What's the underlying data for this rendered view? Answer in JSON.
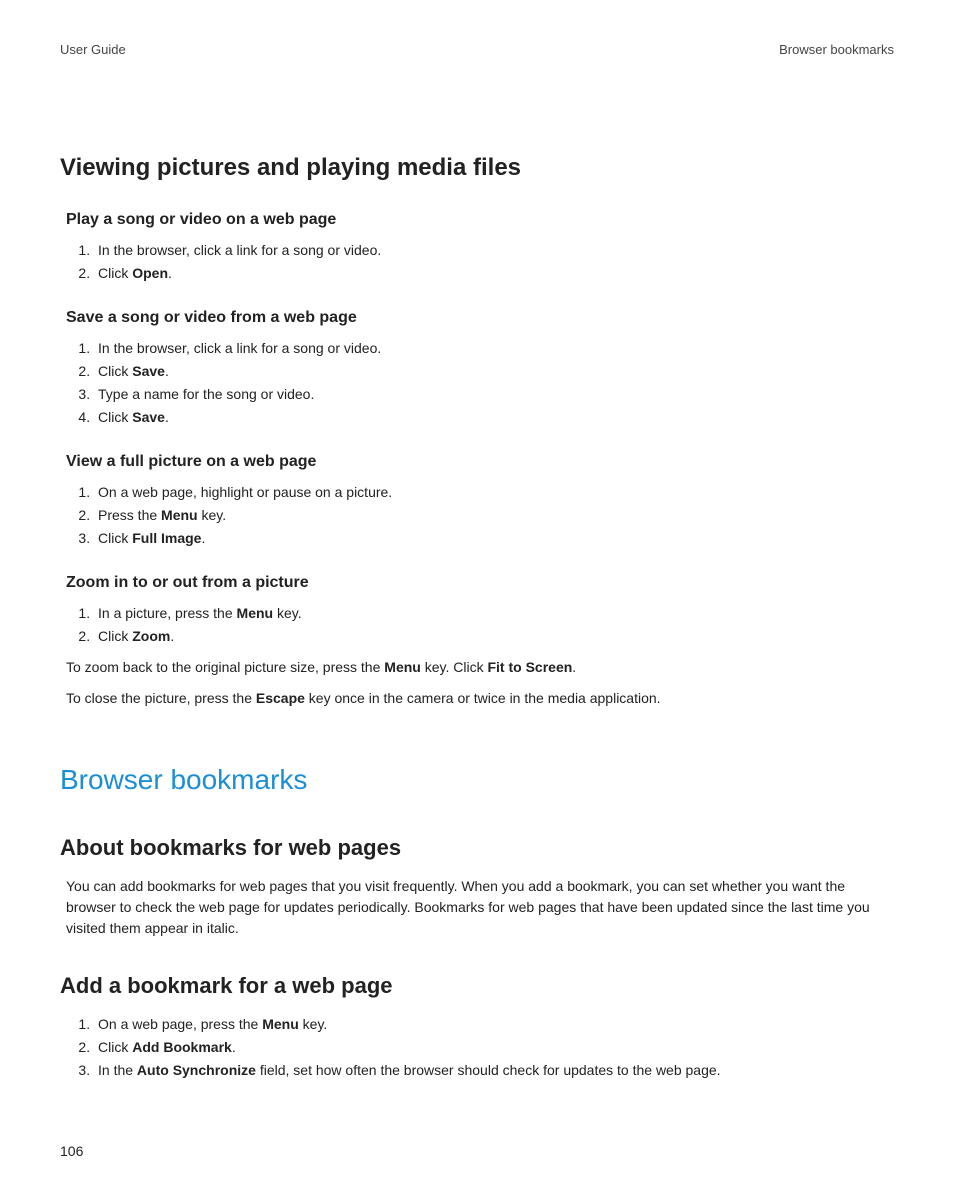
{
  "header": {
    "left": "User Guide",
    "right": "Browser bookmarks"
  },
  "section1": {
    "title": "Viewing pictures and playing media files",
    "topics": [
      {
        "title": "Play a song or video on a web page",
        "steps": [
          [
            {
              "t": "In the browser, click a link for a song or video."
            }
          ],
          [
            {
              "t": "Click "
            },
            {
              "b": "Open"
            },
            {
              "t": "."
            }
          ]
        ]
      },
      {
        "title": "Save a song or video from a web page",
        "steps": [
          [
            {
              "t": "In the browser, click a link for a song or video."
            }
          ],
          [
            {
              "t": "Click "
            },
            {
              "b": "Save"
            },
            {
              "t": "."
            }
          ],
          [
            {
              "t": "Type a name for the song or video."
            }
          ],
          [
            {
              "t": "Click "
            },
            {
              "b": "Save"
            },
            {
              "t": "."
            }
          ]
        ]
      },
      {
        "title": "View a full picture on a web page",
        "steps": [
          [
            {
              "t": "On a web page, highlight or pause on a picture."
            }
          ],
          [
            {
              "t": "Press the "
            },
            {
              "b": "Menu"
            },
            {
              "t": " key."
            }
          ],
          [
            {
              "t": "Click "
            },
            {
              "b": "Full Image"
            },
            {
              "t": "."
            }
          ]
        ]
      },
      {
        "title": "Zoom in to or out from a picture",
        "steps": [
          [
            {
              "t": "In a picture, press the "
            },
            {
              "b": "Menu"
            },
            {
              "t": " key."
            }
          ],
          [
            {
              "t": "Click "
            },
            {
              "b": "Zoom"
            },
            {
              "t": "."
            }
          ]
        ],
        "paragraphs": [
          [
            {
              "t": "To zoom back to the original picture size, press the "
            },
            {
              "b": "Menu"
            },
            {
              "t": " key. Click "
            },
            {
              "b": "Fit to Screen"
            },
            {
              "t": "."
            }
          ],
          [
            {
              "t": "To close the picture, press the "
            },
            {
              "b": "Escape"
            },
            {
              "t": " key once in the camera or twice in the media application."
            }
          ]
        ]
      }
    ]
  },
  "chapter": {
    "title": "Browser bookmarks",
    "subsections": [
      {
        "title": "About bookmarks for web pages",
        "paragraphs": [
          [
            {
              "t": "You can add bookmarks for web pages that you visit frequently. When you add a bookmark, you can set whether you want the browser to check the web page for updates periodically. Bookmarks for web pages that have been updated since the last time you visited them appear in italic."
            }
          ]
        ]
      },
      {
        "title": "Add a bookmark for a web page",
        "steps": [
          [
            {
              "t": "On a web page, press the "
            },
            {
              "b": "Menu"
            },
            {
              "t": " key."
            }
          ],
          [
            {
              "t": "Click "
            },
            {
              "b": "Add Bookmark"
            },
            {
              "t": "."
            }
          ],
          [
            {
              "t": "In the "
            },
            {
              "b": "Auto Synchronize"
            },
            {
              "t": " field, set how often the browser should check for updates to the web page."
            }
          ]
        ]
      }
    ]
  },
  "page_number": "106"
}
